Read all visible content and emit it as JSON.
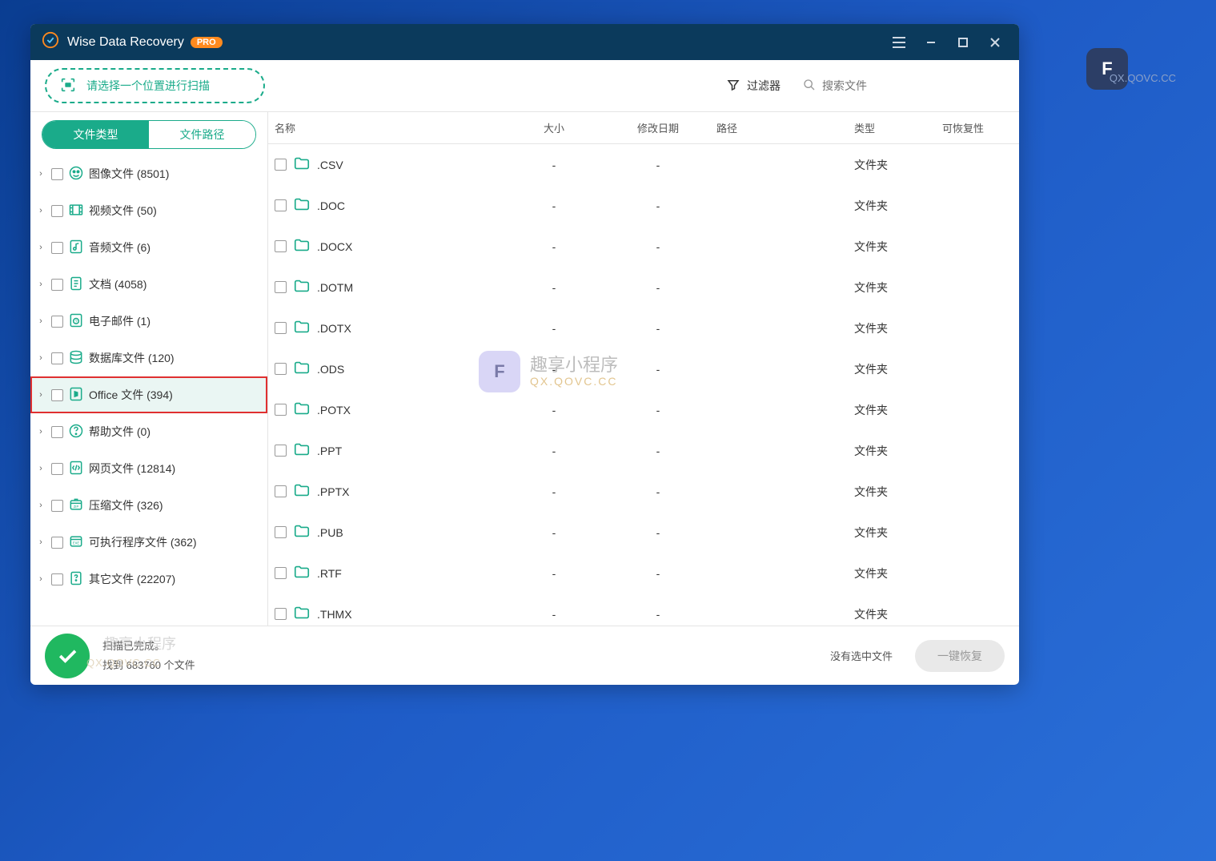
{
  "app": {
    "title": "Wise Data Recovery",
    "badge": "PRO"
  },
  "toolbar": {
    "scan_prompt": "请选择一个位置进行扫描",
    "filter_label": "过滤器",
    "search_placeholder": "搜索文件"
  },
  "sidebar": {
    "tabs": {
      "type": "文件类型",
      "path": "文件路径"
    },
    "items": [
      {
        "label": "图像文件 (8501)",
        "icon": "image"
      },
      {
        "label": "视频文件 (50)",
        "icon": "video"
      },
      {
        "label": "音频文件 (6)",
        "icon": "audio"
      },
      {
        "label": "文档 (4058)",
        "icon": "doc"
      },
      {
        "label": "电子邮件 (1)",
        "icon": "mail"
      },
      {
        "label": "数据库文件 (120)",
        "icon": "db"
      },
      {
        "label": "Office 文件 (394)",
        "icon": "office",
        "selected": true
      },
      {
        "label": "帮助文件 (0)",
        "icon": "help"
      },
      {
        "label": "网页文件 (12814)",
        "icon": "web"
      },
      {
        "label": "压缩文件 (326)",
        "icon": "zip"
      },
      {
        "label": "可执行程序文件 (362)",
        "icon": "exe"
      },
      {
        "label": "其它文件 (22207)",
        "icon": "other"
      }
    ]
  },
  "columns": {
    "name": "名称",
    "size": "大小",
    "date": "修改日期",
    "path": "路径",
    "type": "类型",
    "recover": "可恢复性"
  },
  "files": [
    {
      "name": ".CSV",
      "size": "-",
      "date": "-",
      "type": "文件夹"
    },
    {
      "name": ".DOC",
      "size": "-",
      "date": "-",
      "type": "文件夹"
    },
    {
      "name": ".DOCX",
      "size": "-",
      "date": "-",
      "type": "文件夹"
    },
    {
      "name": ".DOTM",
      "size": "-",
      "date": "-",
      "type": "文件夹"
    },
    {
      "name": ".DOTX",
      "size": "-",
      "date": "-",
      "type": "文件夹"
    },
    {
      "name": ".ODS",
      "size": "-",
      "date": "-",
      "type": "文件夹"
    },
    {
      "name": ".POTX",
      "size": "-",
      "date": "-",
      "type": "文件夹"
    },
    {
      "name": ".PPT",
      "size": "-",
      "date": "-",
      "type": "文件夹"
    },
    {
      "name": ".PPTX",
      "size": "-",
      "date": "-",
      "type": "文件夹"
    },
    {
      "name": ".PUB",
      "size": "-",
      "date": "-",
      "type": "文件夹"
    },
    {
      "name": ".RTF",
      "size": "-",
      "date": "-",
      "type": "文件夹"
    },
    {
      "name": ".THMX",
      "size": "-",
      "date": "-",
      "type": "文件夹"
    }
  ],
  "status": {
    "done": "扫描已完成。",
    "found": "找到 683760 个文件",
    "no_selection": "没有选中文件",
    "recover_btn": "一键恢复"
  },
  "watermarks": {
    "brand": "趣享小程序",
    "url": "QX.QOVC.CC"
  }
}
